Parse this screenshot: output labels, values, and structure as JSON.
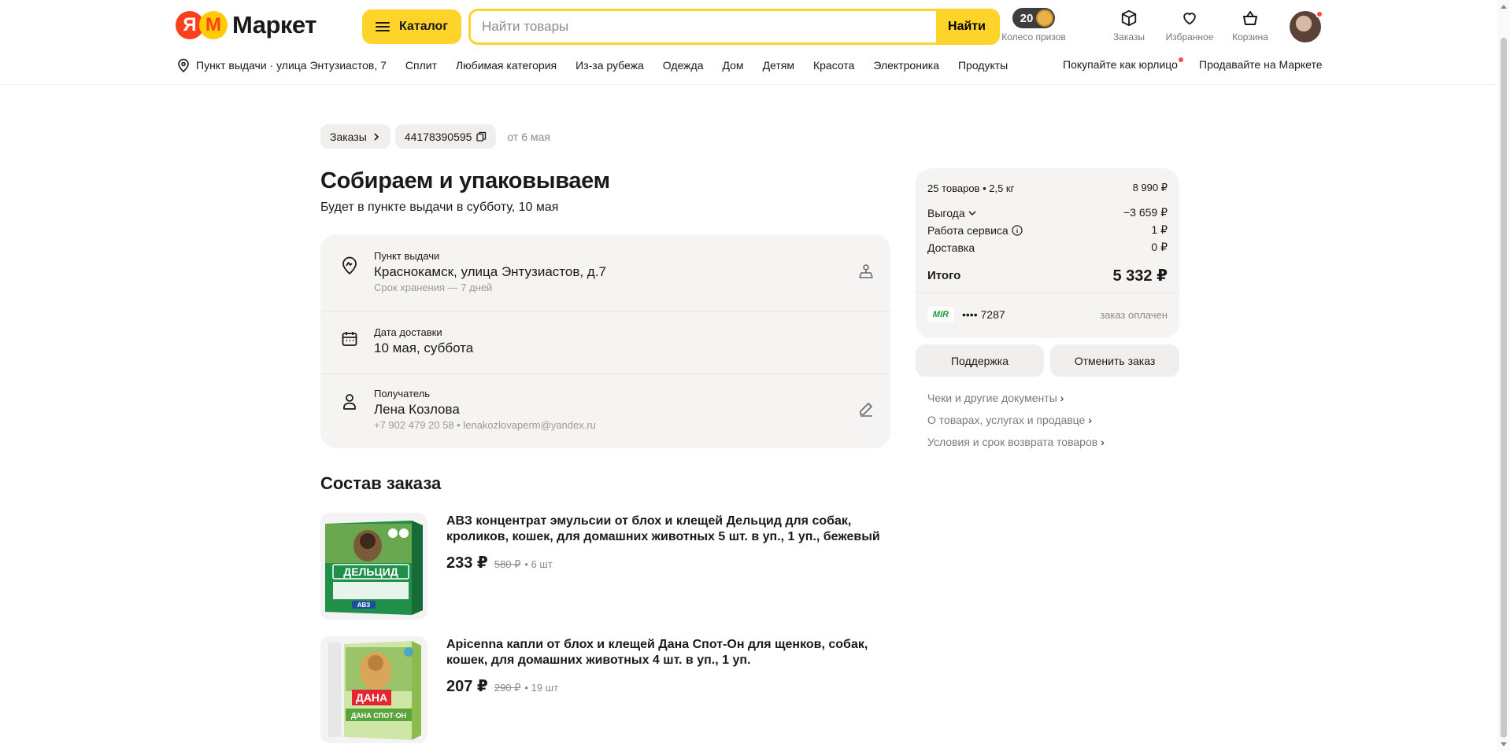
{
  "header": {
    "logo_ya": "Я",
    "logo_m": "М",
    "logo_text": "Маркет",
    "catalog_label": "Каталог",
    "search_placeholder": "Найти товары",
    "search_button": "Найти",
    "prize_count": "20",
    "prize_label": "Колесо призов",
    "orders_label": "Заказы",
    "favorites_label": "Избранное",
    "cart_label": "Корзина"
  },
  "nav": {
    "pickup": "Пункт выдачи · улица Энтузиастов, 7",
    "items": [
      "Сплит",
      "Любимая категория",
      "Из-за рубежа",
      "Одежда",
      "Дом",
      "Детям",
      "Красота",
      "Электроника",
      "Продукты"
    ],
    "business": "Покупайте как юрлицо",
    "sell": "Продавайте на Маркете"
  },
  "breadcrumb": {
    "orders": "Заказы",
    "order_number": "44178390595",
    "date": "от 6 мая"
  },
  "status": {
    "title": "Собираем и упаковываем",
    "subtitle": "Будет в пункте выдачи в субботу, 10 мая"
  },
  "info": {
    "pickup_label": "Пункт выдачи",
    "pickup_value": "Краснокамск, улица Энтузиастов, д.7",
    "pickup_note": "Срок хранения — 7 дней",
    "date_label": "Дата доставки",
    "date_value": "10 мая, суббота",
    "recipient_label": "Получатель",
    "recipient_value": "Лена Козлова",
    "recipient_note": "+7 902 479 20 58 • lenakozlovaperm@yandex.ru"
  },
  "composition_title": "Состав заказа",
  "products": [
    {
      "name": "АВЗ концентрат эмульсии от блох и клещей Дельцид для собак, кроликов, кошек, для домашних животных 5 шт. в уп., 1 уп., бежевый",
      "price": "233 ₽",
      "old_price": "580 ₽",
      "qty": "• 6 шт",
      "box_label": "ДЕЛЬЦИД",
      "brand": "АВЗ"
    },
    {
      "name": "Apicenna капли от блох и клещей Дана Спот-Он для щенков, собак, кошек, для домашних животных 4 шт. в уп., 1 уп.",
      "price": "207 ₽",
      "old_price": "290 ₽",
      "qty": "• 19 шт",
      "box_label": "ДАНА",
      "box_sub": "ДАНА СПОТ-ОН"
    }
  ],
  "summary": {
    "items_label": "25 товаров • 2,5 кг",
    "items_value": "8 990 ₽",
    "benefit_label": "Выгода",
    "benefit_value": "−3 659 ₽",
    "service_label": "Работа сервиса",
    "service_value": "1 ₽",
    "delivery_label": "Доставка",
    "delivery_value": "0 ₽",
    "total_label": "Итого",
    "total_value": "5 332 ₽",
    "card_brand": "MIR",
    "card_mask": "•••• 7287",
    "paid": "заказ оплачен"
  },
  "actions": {
    "support": "Поддержка",
    "cancel": "Отменить заказ"
  },
  "links": {
    "receipts": "Чеки и другие документы",
    "about": "О товарах, услугах и продавце",
    "returns": "Условия и срок возврата товаров"
  },
  "colors": {
    "accent_yellow": "#fed42b",
    "brand_red": "#fc3f1d",
    "card_bg": "#f5f4f2"
  }
}
